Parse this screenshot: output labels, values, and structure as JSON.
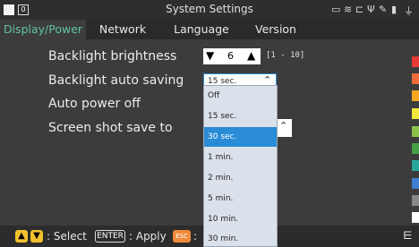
{
  "titlebar": {
    "title": "System Settings",
    "left_badge": "0",
    "status_icons": [
      "monitor-icon",
      "wifi-icon",
      "network-icon",
      "usb-icon",
      "pen-icon",
      "battery-icon",
      "plug-icon"
    ]
  },
  "tabs": [
    {
      "label": "Display/Power",
      "active": true
    },
    {
      "label": "Network",
      "active": false
    },
    {
      "label": "Language",
      "active": false
    },
    {
      "label": "Version",
      "active": false
    }
  ],
  "settings": {
    "brightness_label": "Backlight brightness",
    "brightness_value": "6",
    "brightness_range": "[1 - 10]",
    "auto_saving_label": "Backlight auto saving",
    "auto_saving_value": "15 sec.",
    "auto_power_off_label": "Auto power off",
    "screenshot_label": "Screen shot save to"
  },
  "dropdown": {
    "options": [
      "Off",
      "15 sec.",
      "30 sec.",
      "1 min.",
      "2 min.",
      "5 min.",
      "10 min.",
      "30 min."
    ],
    "selected": "30 sec."
  },
  "bottom": {
    "select_label": ": Select",
    "enter_key": "ENTER",
    "apply_label": ": Apply",
    "esc_key": "ESC",
    "colon": ":"
  },
  "colors": {
    "active_tab": "#5fc3a3",
    "selection": "#2a8cd6",
    "side_marks": [
      "#e53935",
      "#ef6c3a",
      "#f5a623",
      "#f1e63b",
      "#8bc34a",
      "#43a047",
      "#26a69a",
      "#3f7fd1",
      "#888888",
      "#ffffff"
    ]
  }
}
